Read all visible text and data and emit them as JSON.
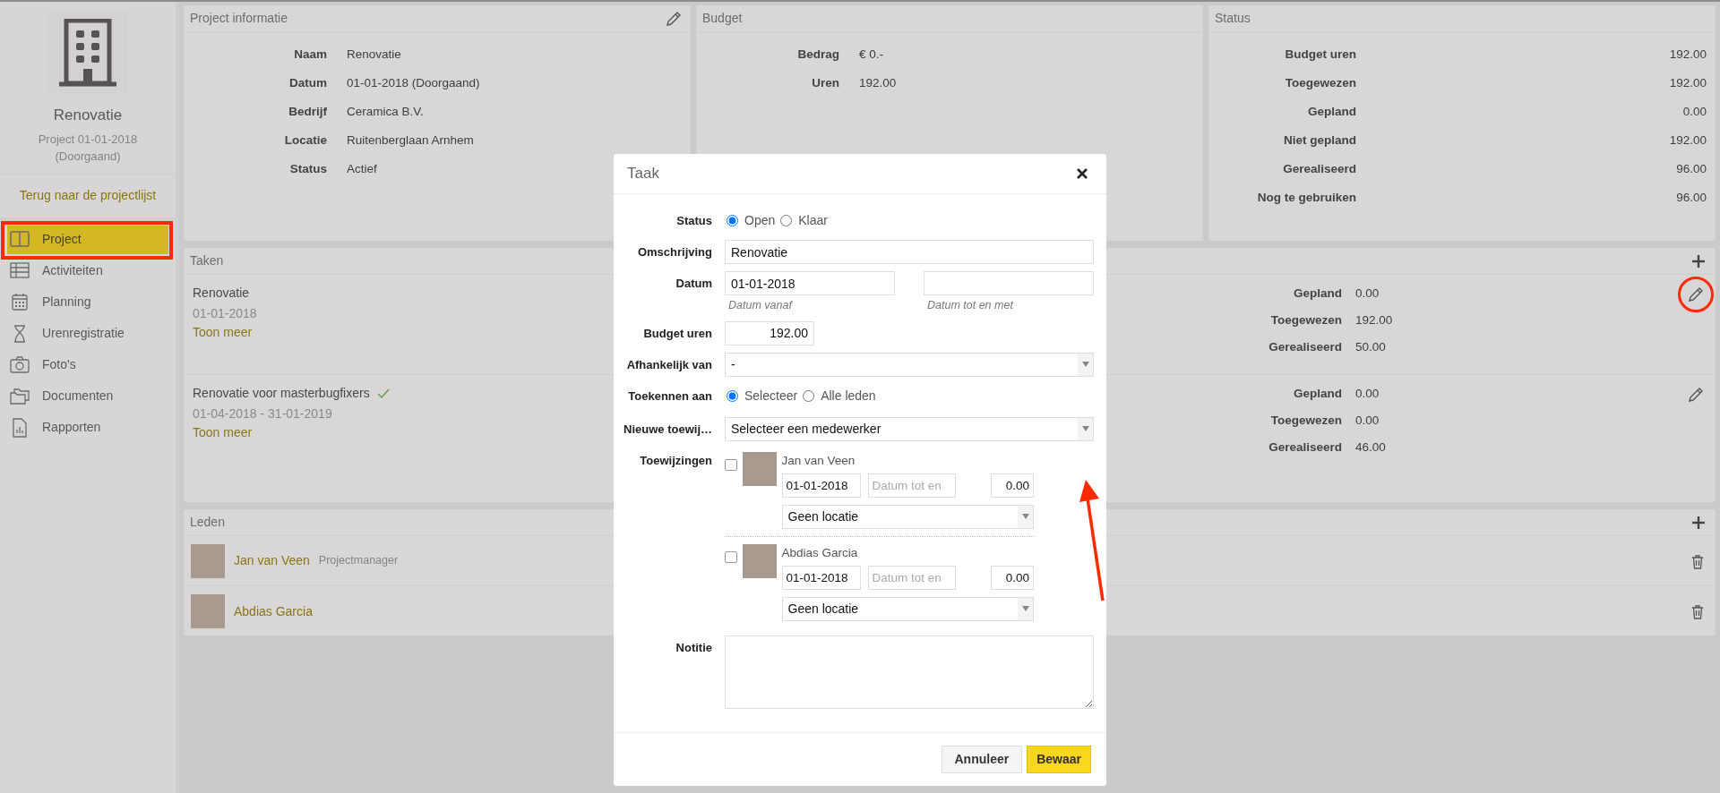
{
  "sidebar": {
    "title": "Renovatie",
    "subtitle": "Project 01-01-2018 (Doorgaand)",
    "back_link": "Terug naar de projectlijst",
    "items": [
      {
        "label": "Project",
        "selected": true,
        "annotated": true
      },
      {
        "label": "Activiteiten",
        "selected": false,
        "annotated": false
      },
      {
        "label": "Planning",
        "selected": false,
        "annotated": false
      },
      {
        "label": "Urenregistratie",
        "selected": false,
        "annotated": false
      },
      {
        "label": "Foto's",
        "selected": false,
        "annotated": false
      },
      {
        "label": "Documenten",
        "selected": false,
        "annotated": false
      },
      {
        "label": "Rapporten",
        "selected": false,
        "annotated": false
      }
    ]
  },
  "project_info": {
    "title": "Project informatie",
    "fields": [
      {
        "label": "Naam",
        "value": "Renovatie"
      },
      {
        "label": "Datum",
        "value": "01-01-2018 (Doorgaand)"
      },
      {
        "label": "Bedrijf",
        "value": "Ceramica B.V."
      },
      {
        "label": "Locatie",
        "value": "Ruitenberglaan Arnhem"
      },
      {
        "label": "Status",
        "value": "Actief"
      }
    ]
  },
  "budget": {
    "title": "Budget",
    "fields": [
      {
        "label": "Bedrag",
        "value": "€ 0.-"
      },
      {
        "label": "Uren",
        "value": "192.00"
      }
    ]
  },
  "status": {
    "title": "Status",
    "fields": [
      {
        "label": "Budget uren",
        "value": "192.00"
      },
      {
        "label": "Toegewezen",
        "value": "192.00"
      },
      {
        "label": "Gepland",
        "value": "0.00"
      },
      {
        "label": "Niet gepland",
        "value": "192.00"
      },
      {
        "label": "Gerealiseerd",
        "value": "96.00"
      },
      {
        "label": "Nog te gebruiken",
        "value": "96.00"
      }
    ]
  },
  "tasks": {
    "title": "Taken",
    "items": [
      {
        "name": "Renovatie",
        "done": false,
        "dates": "01-01-2018",
        "more_link": "Toon meer",
        "annotated": true,
        "stats": [
          {
            "label": "Gepland",
            "value": "0.00"
          },
          {
            "label": "Toegewezen",
            "value": "192.00"
          },
          {
            "label": "Gerealiseerd",
            "value": "50.00"
          }
        ]
      },
      {
        "name": "Renovatie voor masterbugfixers",
        "done": true,
        "dates": "01-04-2018 - 31-01-2019",
        "more_link": "Toon meer",
        "annotated": false,
        "stats": [
          {
            "label": "Gepland",
            "value": "0.00"
          },
          {
            "label": "Toegewezen",
            "value": "0.00"
          },
          {
            "label": "Gerealiseerd",
            "value": "46.00"
          }
        ]
      }
    ]
  },
  "members": {
    "title": "Leden",
    "items": [
      {
        "name": "Jan van Veen",
        "role": "Projectmanager"
      },
      {
        "name": "Abdias Garcia"
      }
    ]
  },
  "modal": {
    "title": "Taak",
    "status": {
      "label": "Status",
      "options": [
        {
          "label": "Open",
          "selected": true
        },
        {
          "label": "Klaar",
          "selected": false
        }
      ]
    },
    "description": {
      "label": "Omschrijving",
      "value": "Renovatie"
    },
    "date": {
      "label": "Datum",
      "from_value": "01-01-2018",
      "from_hint": "Datum vanaf",
      "to_hint": "Datum tot en met"
    },
    "budget_hours": {
      "label": "Budget uren",
      "value": "192.00"
    },
    "depends_on": {
      "label": "Afhankelijk van",
      "value": "-"
    },
    "assign_to": {
      "label": "Toekennen aan",
      "options": [
        {
          "label": "Selecteer",
          "selected": true
        },
        {
          "label": "Alle leden",
          "selected": false
        }
      ]
    },
    "new_assignment": {
      "label": "Nieuwe toewij…",
      "value": "Selecteer een medewerker",
      "arrow_annotation": true
    },
    "assignments": {
      "label": "Toewijzingen",
      "items": [
        {
          "name": "Jan van Veen",
          "checked": false,
          "from": "01-01-2018",
          "to_placeholder": "Datum tot en",
          "hours": "0.00",
          "location": "Geen locatie"
        },
        {
          "name": "Abdias Garcia",
          "checked": false,
          "from": "01-01-2018",
          "to_placeholder": "Datum tot en",
          "hours": "0.00",
          "location": "Geen locatie"
        }
      ]
    },
    "note": {
      "label": "Notitie"
    },
    "buttons": [
      {
        "label": "Annuleer",
        "kind": "secondary"
      },
      {
        "label": "Bewaar",
        "kind": "primary"
      }
    ]
  }
}
